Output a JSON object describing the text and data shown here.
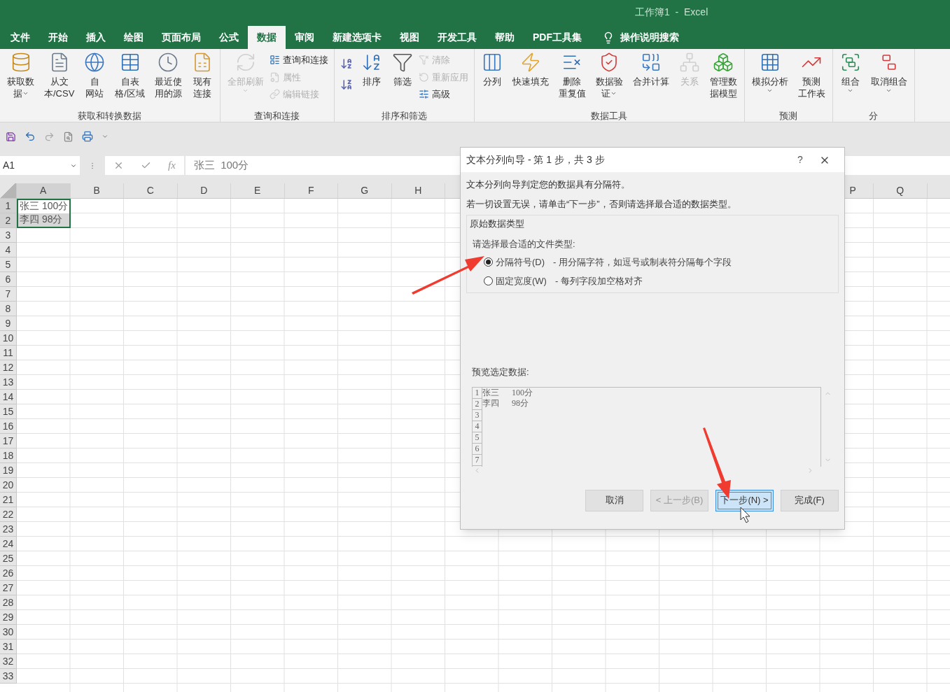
{
  "window": {
    "title": "工作簿1  -  Excel"
  },
  "tabs": [
    {
      "label": "文件",
      "selected": false
    },
    {
      "label": "开始",
      "selected": false
    },
    {
      "label": "插入",
      "selected": false
    },
    {
      "label": "绘图",
      "selected": false
    },
    {
      "label": "页面布局",
      "selected": false
    },
    {
      "label": "公式",
      "selected": false
    },
    {
      "label": "数据",
      "selected": true
    },
    {
      "label": "审阅",
      "selected": false
    },
    {
      "label": "新建选项卡",
      "selected": false
    },
    {
      "label": "视图",
      "selected": false
    },
    {
      "label": "开发工具",
      "selected": false
    },
    {
      "label": "帮助",
      "selected": false
    },
    {
      "label": "PDF工具集",
      "selected": false
    }
  ],
  "tell_me": {
    "placeholder": "操作说明搜索"
  },
  "ribbon": [
    {
      "label": "获取和转换数据",
      "items": [
        {
          "kind": "large",
          "lines": [
            "获取数",
            "据"
          ],
          "dropdown": true,
          "disabled": false
        },
        {
          "kind": "large",
          "lines": [
            "从文",
            "本/CSV"
          ],
          "dropdown": false,
          "disabled": false
        },
        {
          "kind": "large",
          "lines": [
            "自",
            "网站"
          ],
          "dropdown": false,
          "disabled": false
        },
        {
          "kind": "large",
          "lines": [
            "自表",
            "格/区域"
          ],
          "dropdown": false,
          "disabled": false
        },
        {
          "kind": "large",
          "lines": [
            "最近使",
            "用的源"
          ],
          "dropdown": false,
          "disabled": false
        },
        {
          "kind": "large",
          "lines": [
            "现有",
            "连接"
          ],
          "dropdown": false,
          "disabled": false
        }
      ]
    },
    {
      "label": "查询和连接",
      "items": [
        {
          "kind": "large",
          "lines": [
            "全部刷新"
          ],
          "dropdown": true,
          "disabled": true
        },
        {
          "kind": "stack",
          "children": [
            {
              "label": "查询和连接",
              "disabled": false
            },
            {
              "label": "属性",
              "disabled": true
            },
            {
              "label": "编辑链接",
              "disabled": true
            }
          ]
        }
      ]
    },
    {
      "label": "排序和筛选",
      "items": [
        {
          "kind": "sort",
          "children": [
            {
              "disabled": false
            },
            {
              "disabled": false
            }
          ]
        },
        {
          "kind": "large",
          "lines": [
            "排序"
          ],
          "dropdown": false,
          "disabled": false
        },
        {
          "kind": "large",
          "lines": [
            "筛选"
          ],
          "dropdown": false,
          "disabled": false
        },
        {
          "kind": "stack",
          "children": [
            {
              "label": "清除",
              "disabled": true
            },
            {
              "label": "重新应用",
              "disabled": true
            },
            {
              "label": "高级",
              "disabled": false
            }
          ]
        }
      ]
    },
    {
      "label": "数据工具",
      "items": [
        {
          "kind": "large",
          "lines": [
            "分列"
          ],
          "dropdown": false,
          "disabled": false
        },
        {
          "kind": "large",
          "lines": [
            "快速填充"
          ],
          "dropdown": false,
          "disabled": false
        },
        {
          "kind": "large",
          "lines": [
            "删除",
            "重复值"
          ],
          "dropdown": false,
          "disabled": false
        },
        {
          "kind": "large",
          "lines": [
            "数据验",
            "证"
          ],
          "dropdown": true,
          "disabled": false
        },
        {
          "kind": "large",
          "lines": [
            "合并计算"
          ],
          "dropdown": false,
          "disabled": false
        },
        {
          "kind": "large",
          "lines": [
            "关系"
          ],
          "dropdown": false,
          "disabled": true
        },
        {
          "kind": "large",
          "lines": [
            "管理数",
            "据模型"
          ],
          "dropdown": false,
          "disabled": false
        }
      ]
    },
    {
      "label": "预测",
      "items": [
        {
          "kind": "large",
          "lines": [
            "模拟分析"
          ],
          "dropdown": true,
          "disabled": false
        },
        {
          "kind": "large",
          "lines": [
            "预测",
            "工作表"
          ],
          "dropdown": false,
          "disabled": false
        }
      ]
    },
    {
      "label": "分",
      "items": [
        {
          "kind": "large",
          "lines": [
            "组合"
          ],
          "dropdown": true,
          "disabled": false
        },
        {
          "kind": "large",
          "lines": [
            "取消组合"
          ],
          "dropdown": true,
          "disabled": false
        }
      ]
    }
  ],
  "formula_bar": {
    "name_box": "A1",
    "function_label": "fx",
    "formula": "张三  100分"
  },
  "sheet": {
    "columns": [
      "A",
      "B",
      "C",
      "D",
      "E",
      "F",
      "G",
      "H",
      "P",
      "Q"
    ],
    "row_count_labels": [
      "1",
      "2",
      "3",
      "4",
      "5",
      "6",
      "7",
      "8",
      "9",
      "10",
      "11",
      "12",
      "13",
      "14",
      "15",
      "16",
      "17",
      "18",
      "19",
      "20",
      "21",
      "22",
      "23",
      "24",
      "25",
      "26",
      "27",
      "28",
      "29",
      "30",
      "31",
      "32",
      "33"
    ],
    "cells": [
      {
        "text": "张三  100分",
        "selected": false
      },
      {
        "text": "李四  98分",
        "selected": true
      }
    ]
  },
  "dialog": {
    "title": "文本分列向导 - 第 1 步，共 3 步",
    "help": "?",
    "intro": "文本分列向导判定您的数据具有分隔符。",
    "instruction": "若一切设置无误，请单击“下一步”，否则请选择最合适的数据类型。",
    "group_title": "原始数据类型",
    "prompt": "请选择最合适的文件类型:",
    "options": [
      {
        "label": "分隔符号(D)",
        "description": "- 用分隔字符，如逗号或制表符分隔每个字段",
        "selected": true
      },
      {
        "label": "固定宽度(W)",
        "description": "- 每列字段加空格对齐",
        "selected": false
      }
    ],
    "preview_label": "预览选定数据:",
    "preview_line_numbers": [
      "1",
      "2",
      "3",
      "4",
      "5",
      "6",
      "7"
    ],
    "preview_rows": [
      [
        "张三",
        "100分"
      ],
      [
        "李四",
        "98分"
      ]
    ],
    "buttons": [
      {
        "label": "取消",
        "disabled": false,
        "selected": false
      },
      {
        "label": "< 上一步(B)",
        "disabled": true,
        "selected": false
      },
      {
        "label": "下一步(N) >",
        "disabled": false,
        "selected": true
      },
      {
        "label": "完成(F)",
        "disabled": false,
        "selected": false
      }
    ]
  }
}
